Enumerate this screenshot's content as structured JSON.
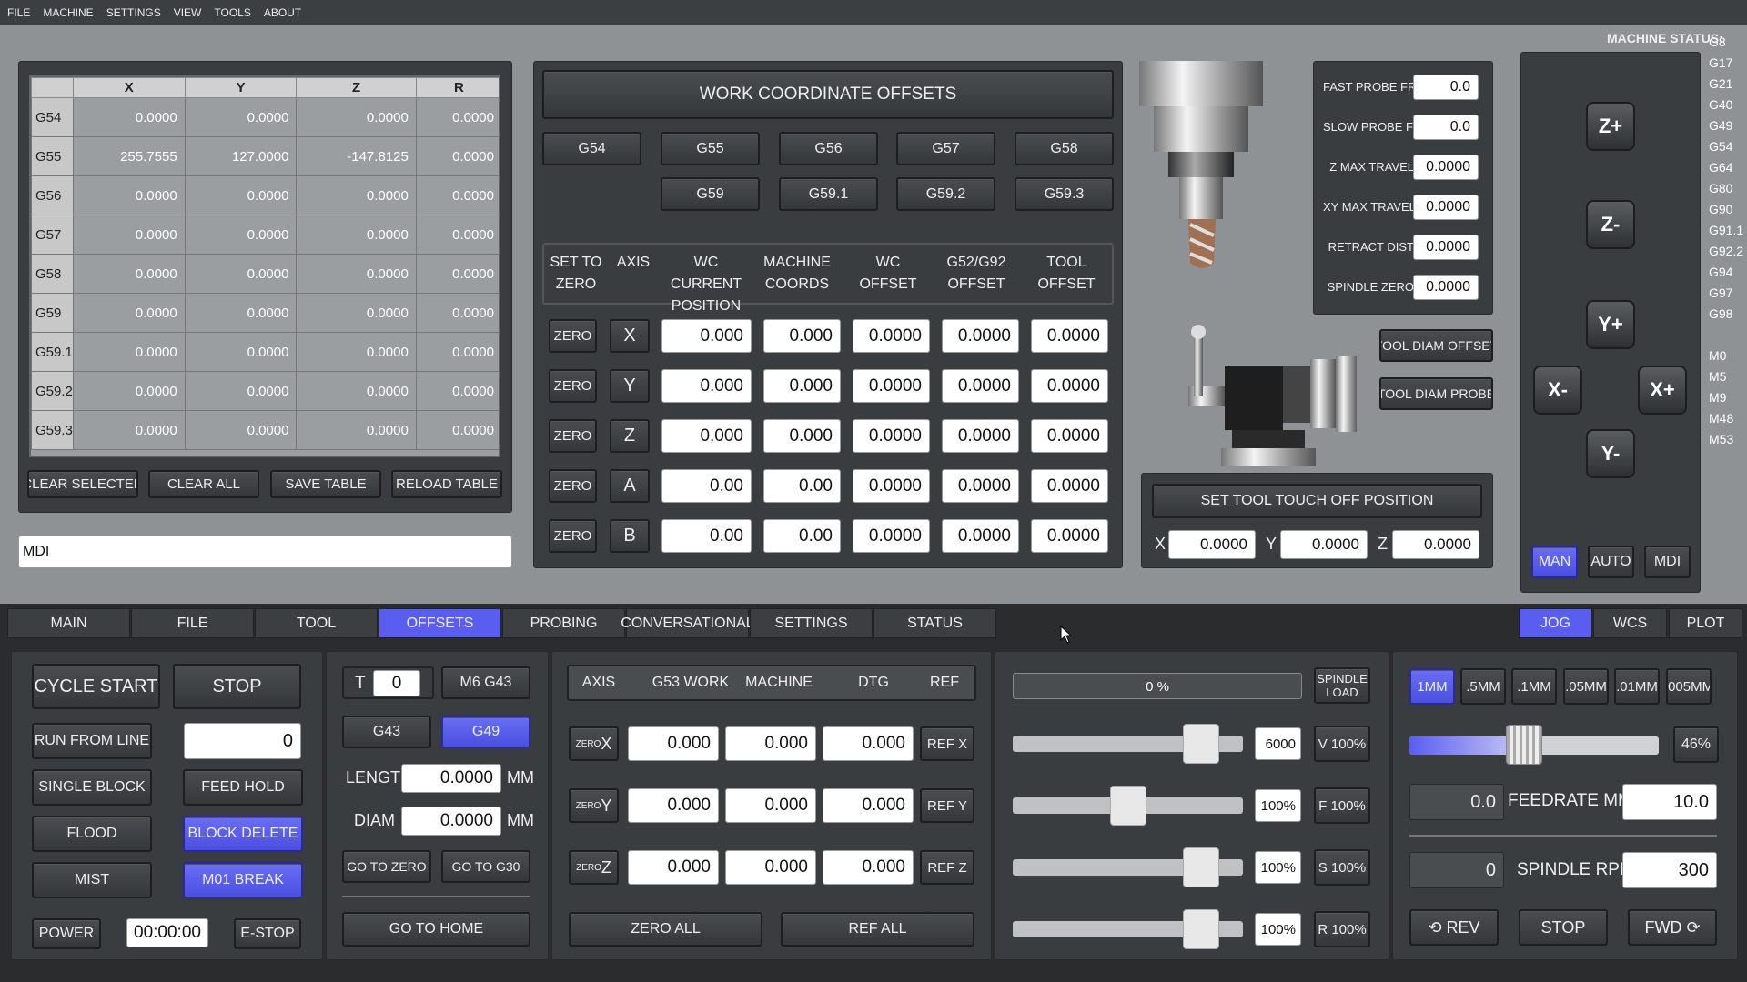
{
  "menu": [
    "FILE",
    "MACHINE",
    "SETTINGS",
    "VIEW",
    "TOOLS",
    "ABOUT"
  ],
  "machine_status_label": "MACHINE STATUS:",
  "status_gcodes": [
    "G8",
    "G17",
    "G21",
    "G40",
    "G49",
    "G54",
    "G64",
    "G80",
    "G90",
    "G91.1",
    "G92.2",
    "G94",
    "G97",
    "G98",
    "",
    "M0",
    "M5",
    "M9",
    "M48",
    "M53"
  ],
  "offset_table": {
    "headers": [
      "X",
      "Y",
      "Z",
      "R"
    ],
    "rows": [
      {
        "name": "G54",
        "vals": [
          "0.0000",
          "0.0000",
          "0.0000",
          "0.0000"
        ]
      },
      {
        "name": "G55",
        "vals": [
          "255.7555",
          "127.0000",
          "-147.8125",
          "0.0000"
        ]
      },
      {
        "name": "G56",
        "vals": [
          "0.0000",
          "0.0000",
          "0.0000",
          "0.0000"
        ]
      },
      {
        "name": "G57",
        "vals": [
          "0.0000",
          "0.0000",
          "0.0000",
          "0.0000"
        ]
      },
      {
        "name": "G58",
        "vals": [
          "0.0000",
          "0.0000",
          "0.0000",
          "0.0000"
        ]
      },
      {
        "name": "G59",
        "vals": [
          "0.0000",
          "0.0000",
          "0.0000",
          "0.0000"
        ]
      },
      {
        "name": "G59.1",
        "vals": [
          "0.0000",
          "0.0000",
          "0.0000",
          "0.0000"
        ]
      },
      {
        "name": "G59.2",
        "vals": [
          "0.0000",
          "0.0000",
          "0.0000",
          "0.0000"
        ]
      },
      {
        "name": "G59.3",
        "vals": [
          "0.0000",
          "0.0000",
          "0.0000",
          "0.0000"
        ]
      }
    ],
    "buttons": [
      "CLEAR SELECTED",
      "CLEAR ALL",
      "SAVE TABLE",
      "RELOAD TABLE"
    ]
  },
  "mdi_value": "MDI",
  "wco": {
    "title": "WORK COORDINATE OFFSETS",
    "row1": [
      "G54",
      "G55",
      "G56",
      "G57",
      "G58"
    ],
    "row2": [
      "G59",
      "G59.1",
      "G59.2",
      "G59.3"
    ],
    "headers": [
      "SET TO ZERO",
      "AXIS",
      "WC CURRENT POSITION",
      "MACHINE COORDS",
      "WC OFFSET",
      "G52/G92 OFFSET",
      "TOOL OFFSET"
    ],
    "zero_label": "ZERO",
    "rows": [
      {
        "axis": "X",
        "wc": "0.000",
        "mc": "0.000",
        "wco": "0.0000",
        "g52": "0.0000",
        "tool": "0.0000"
      },
      {
        "axis": "Y",
        "wc": "0.000",
        "mc": "0.000",
        "wco": "0.0000",
        "g52": "0.0000",
        "tool": "0.0000"
      },
      {
        "axis": "Z",
        "wc": "0.000",
        "mc": "0.000",
        "wco": "0.0000",
        "g52": "0.0000",
        "tool": "0.0000"
      },
      {
        "axis": "A",
        "wc": "0.00",
        "mc": "0.00",
        "wco": "0.0000",
        "g52": "0.0000",
        "tool": "0.0000"
      },
      {
        "axis": "B",
        "wc": "0.00",
        "mc": "0.00",
        "wco": "0.0000",
        "g52": "0.0000",
        "tool": "0.0000"
      }
    ]
  },
  "probe": [
    {
      "label": "FAST PROBE FR",
      "value": "0.0"
    },
    {
      "label": "SLOW PROBE FR",
      "value": "0.0"
    },
    {
      "label": "Z MAX TRAVEL",
      "value": "0.0000"
    },
    {
      "label": "XY MAX TRAVEL",
      "value": "0.0000"
    },
    {
      "label": "RETRACT DIST",
      "value": "0.0000"
    },
    {
      "label": "SPINDLE ZERO",
      "value": "0.0000"
    }
  ],
  "tool_diam_offset": "TOOL DIAM OFFSET",
  "tool_diam_probe": "TOOL DIAM PROBE",
  "touchoff": {
    "title": "SET TOOL TOUCH OFF POSITION",
    "x_label": "X",
    "x": "0.0000",
    "y_label": "Y",
    "y": "0.0000",
    "z_label": "Z",
    "z": "0.0000"
  },
  "jog_arrows": {
    "zp": "Z+",
    "zm": "Z-",
    "yp": "Y+",
    "ym": "Y-",
    "xm": "X-",
    "xp": "X+"
  },
  "modes": [
    "MAN",
    "AUTO",
    "MDI"
  ],
  "tabs": [
    "MAIN",
    "FILE",
    "TOOL",
    "OFFSETS",
    "PROBING",
    "CONVERSATIONAL",
    "SETTINGS",
    "STATUS"
  ],
  "right_tabs": [
    "JOG",
    "WCS",
    "PLOT"
  ],
  "run": {
    "cycle_start": "CYCLE START",
    "stop": "STOP",
    "run_from_line": "RUN FROM LINE",
    "line": "0",
    "single_block": "SINGLE BLOCK",
    "feed_hold": "FEED HOLD",
    "flood": "FLOOD",
    "block_delete": "BLOCK DELETE",
    "mist": "MIST",
    "m01_break": "M01 BREAK",
    "power": "POWER",
    "timer": "00:00:00",
    "estop": "E-STOP"
  },
  "tool": {
    "t_label": "T",
    "t_value": "0",
    "m6": "M6 G43",
    "g43": "G43",
    "g49": "G49",
    "length_label": "LENGTH",
    "length": "0.0000",
    "diam_label": "DIAM",
    "diam": "0.0000",
    "unit": "MM",
    "go_zero": "GO TO ZERO",
    "go_g30": "GO TO G30",
    "go_home": "GO TO HOME"
  },
  "dro": {
    "headers": [
      "AXIS",
      "G53 WORK",
      "MACHINE",
      "DTG",
      "REF"
    ],
    "rows": [
      {
        "zero": "ZERO",
        "axis": "X",
        "work": "0.000",
        "machine": "0.000",
        "dtg": "0.000",
        "ref": "REF X"
      },
      {
        "zero": "ZERO",
        "axis": "Y",
        "work": "0.000",
        "machine": "0.000",
        "dtg": "0.000",
        "ref": "REF Y"
      },
      {
        "zero": "ZERO",
        "axis": "Z",
        "work": "0.000",
        "machine": "0.000",
        "dtg": "0.000",
        "ref": "REF Z"
      }
    ],
    "zero_all": "ZERO ALL",
    "ref_all": "REF ALL"
  },
  "overrides": {
    "load_bar": "0 %",
    "load_percent": 0,
    "spindle_load": "SPINDLE LOAD",
    "rows": [
      {
        "value": "6000",
        "btn": "V 100%",
        "level": 0.88
      },
      {
        "value": "100%",
        "btn": "F 100%",
        "level": 0.5
      },
      {
        "value": "100%",
        "btn": "S 100%",
        "level": 0.88
      },
      {
        "value": "100%",
        "btn": "R 100%",
        "level": 0.88
      }
    ]
  },
  "jog": {
    "steps": [
      "1MM",
      ".5MM",
      ".1MM",
      ".05MM",
      ".01MM",
      ".005MM"
    ],
    "jog_percent": "46%",
    "jog_level": 0.46,
    "feed_actual": "0.0",
    "feed_label": "FEEDRATE MM/M",
    "feed_set": "10.0",
    "rpm_actual": "0",
    "rpm_label": "SPINDLE RPM",
    "rpm_set": "300",
    "rev": "⟲ REV",
    "stop": "STOP",
    "fwd": "FWD ⟳"
  }
}
